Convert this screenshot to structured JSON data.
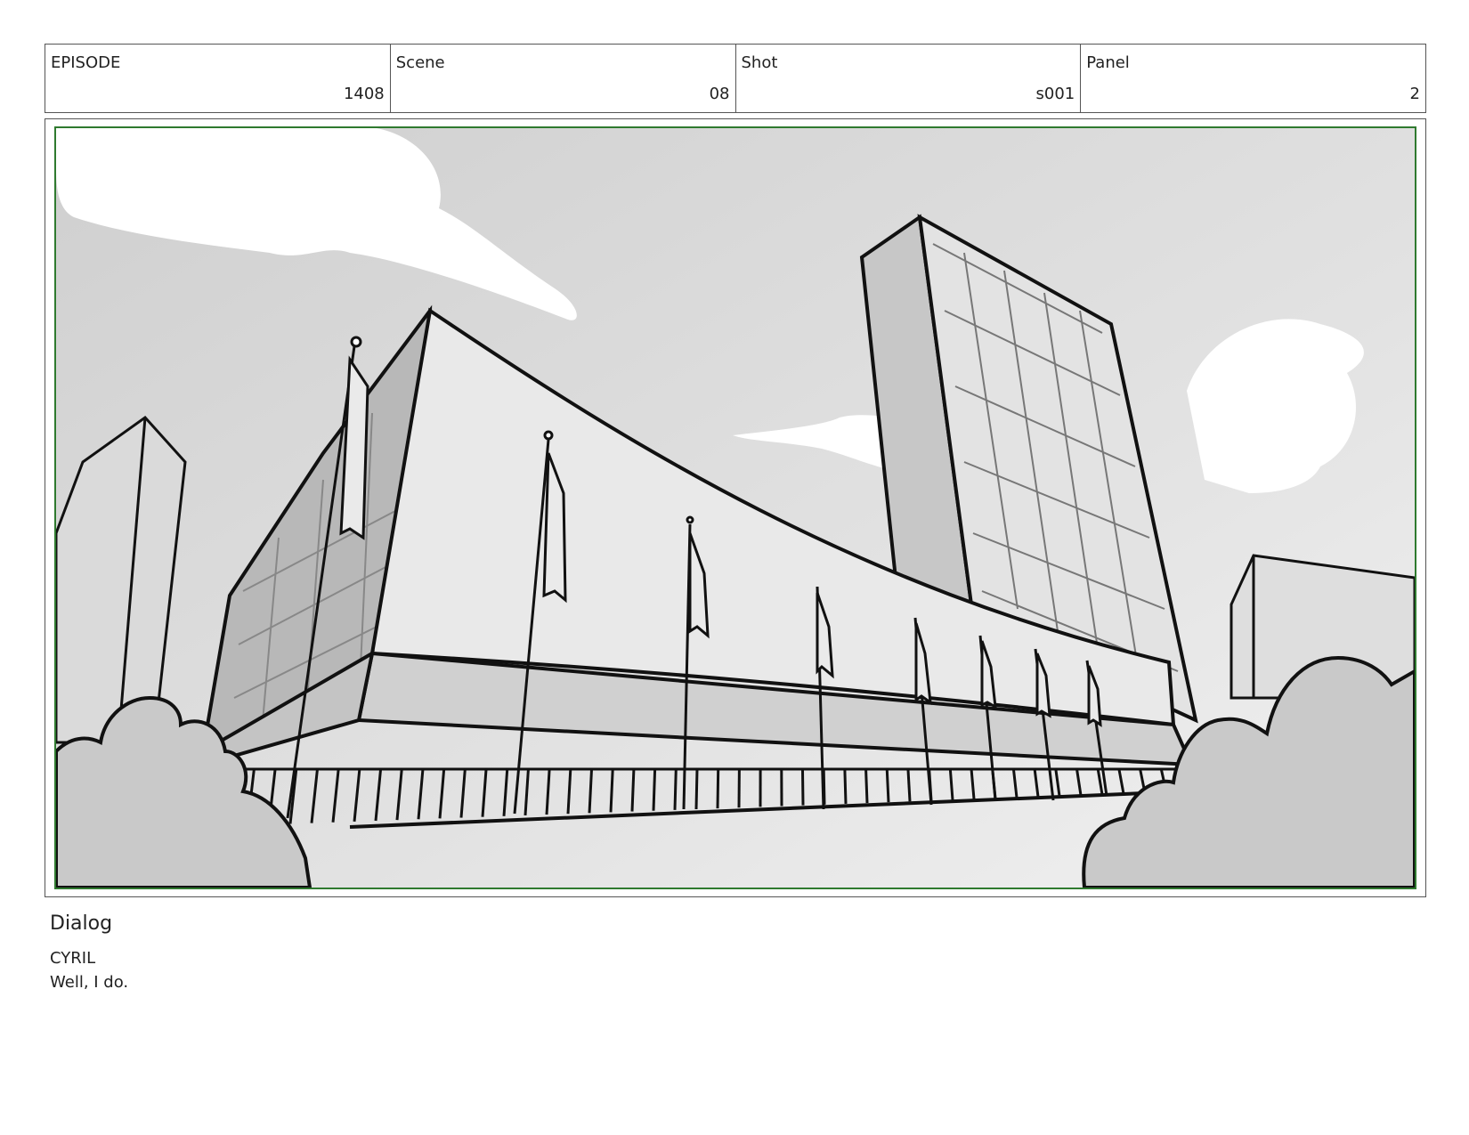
{
  "header": {
    "episode": {
      "label": "EPISODE",
      "value": "1408"
    },
    "scene": {
      "label": "Scene",
      "value": "08"
    },
    "shot": {
      "label": "Shot",
      "value": "s001"
    },
    "panel": {
      "label": "Panel",
      "value": "2"
    }
  },
  "dialog": {
    "title": "Dialog",
    "character": "CYRIL",
    "line": "Well, I do."
  },
  "colors": {
    "frame_border": "#555555",
    "safe_area_border": "#2f7a2f",
    "sky": "#d6d6d6",
    "bushes": "#c9c9c9"
  }
}
